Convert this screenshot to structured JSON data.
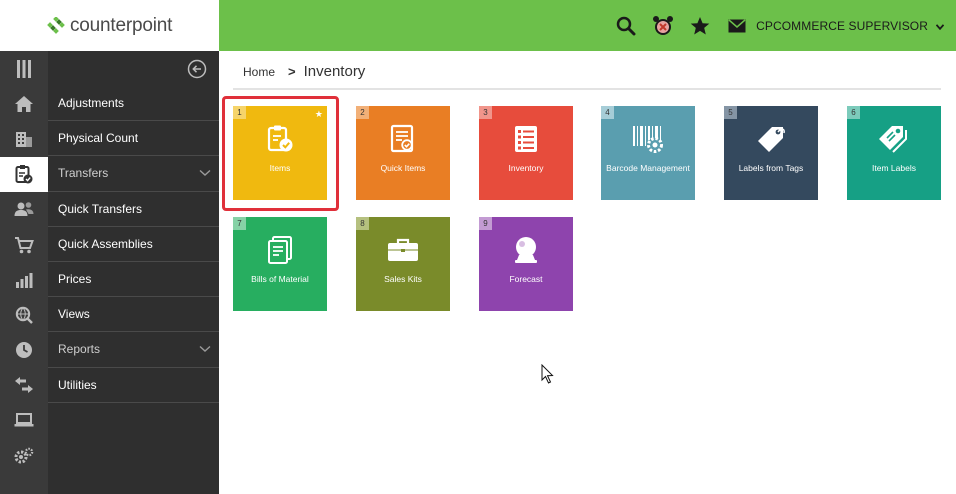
{
  "brand": {
    "name": "counterpoint"
  },
  "topbar": {
    "icons": [
      "search-icon",
      "alarm-clock-icon",
      "star-icon",
      "mail-icon"
    ],
    "user": "CPCOMMERCE SUPERVISOR"
  },
  "rail": {
    "icons": [
      "grid-icon",
      "home-icon",
      "building-icon",
      "clipboard-check-icon",
      "users-icon",
      "cart-icon",
      "bar-chart-icon",
      "search-globe-icon",
      "clock-icon",
      "transfer-arrows-icon",
      "laptop-icon",
      "gears-icon"
    ]
  },
  "menu": {
    "items": [
      {
        "label": "Adjustments",
        "expandable": false
      },
      {
        "label": "Physical Count",
        "expandable": false
      },
      {
        "label": "Transfers",
        "expandable": true
      },
      {
        "label": "Quick Transfers",
        "expandable": false
      },
      {
        "label": "Quick Assemblies",
        "expandable": false
      },
      {
        "label": "Prices",
        "expandable": false
      },
      {
        "label": "Views",
        "expandable": false
      },
      {
        "label": "Reports",
        "expandable": true
      },
      {
        "label": "Utilities",
        "expandable": false
      }
    ]
  },
  "breadcrumb": {
    "home": "Home",
    "separator": ">",
    "current": "Inventory"
  },
  "tiles": [
    {
      "num": "1",
      "label": "Items",
      "color": "#f0b90f",
      "numbg": "#f6d46a",
      "icon": "clipboard-check-icon",
      "favorite": true
    },
    {
      "num": "2",
      "label": "Quick Items",
      "color": "#e97e24",
      "numbg": "#f2b078",
      "icon": "document-check-icon"
    },
    {
      "num": "3",
      "label": "Inventory",
      "color": "#e74c3c",
      "numbg": "#f1958b",
      "icon": "list-icon"
    },
    {
      "num": "4",
      "label": "Barcode Management",
      "color": "#5a9eaf",
      "numbg": "#a6cdd7",
      "icon": "barcode-gear-icon"
    },
    {
      "num": "5",
      "label": "Labels from Tags",
      "color": "#34495e",
      "numbg": "#8595a5",
      "icon": "tag-icon"
    },
    {
      "num": "6",
      "label": "Item Labels",
      "color": "#16a085",
      "numbg": "#7ccbbb",
      "icon": "tags-icon"
    },
    {
      "num": "7",
      "label": "Bills of Material",
      "color": "#27ae60",
      "numbg": "#86d2a6",
      "icon": "document-stack-icon"
    },
    {
      "num": "8",
      "label": "Sales Kits",
      "color": "#7a8b2a",
      "numbg": "#b5c07f",
      "icon": "briefcase-icon"
    },
    {
      "num": "9",
      "label": "Forecast",
      "color": "#8e44ad",
      "numbg": "#c39bd3",
      "icon": "crystal-ball-icon"
    }
  ],
  "colors": {
    "accent_green": "#6cc04a",
    "sidebar_dark": "#2f2f2f",
    "highlight_red": "#e0303a"
  }
}
